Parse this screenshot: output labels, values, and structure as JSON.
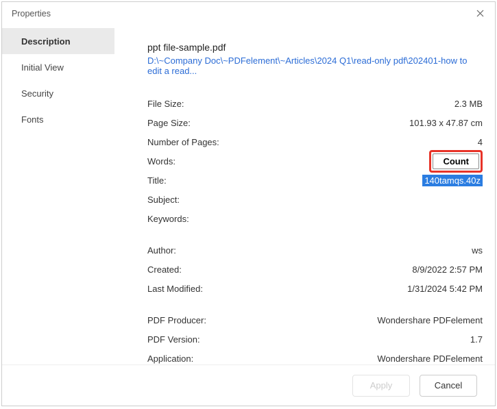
{
  "window": {
    "title": "Properties"
  },
  "sidebar": {
    "items": [
      {
        "label": "Description"
      },
      {
        "label": "Initial View"
      },
      {
        "label": "Security"
      },
      {
        "label": "Fonts"
      }
    ]
  },
  "file": {
    "name": "ppt file-sample.pdf",
    "path": "D:\\~Company Doc\\~PDFelement\\~Articles\\2024 Q1\\read-only pdf\\202401-how to edit a read..."
  },
  "rows": {
    "file_size": {
      "label": "File Size:",
      "value": "2.3 MB"
    },
    "page_size": {
      "label": "Page Size:",
      "value": "101.93 x 47.87 cm"
    },
    "pages": {
      "label": "Number of Pages:",
      "value": "4"
    },
    "words": {
      "label": "Words:",
      "count_button": "Count"
    },
    "title": {
      "label": "Title:",
      "value": "140tamqs.40z"
    },
    "subject": {
      "label": "Subject:",
      "value": ""
    },
    "keywords": {
      "label": "Keywords:",
      "value": ""
    },
    "author": {
      "label": "Author:",
      "value": "ws"
    },
    "created": {
      "label": "Created:",
      "value": "8/9/2022 2:57 PM"
    },
    "modified": {
      "label": "Last Modified:",
      "value": "1/31/2024 5:42 PM"
    },
    "producer": {
      "label": "PDF Producer:",
      "value": "Wondershare PDFelement"
    },
    "version": {
      "label": "PDF Version:",
      "value": "1.7"
    },
    "application": {
      "label": "Application:",
      "value": "Wondershare PDFelement"
    }
  },
  "footer": {
    "apply": "Apply",
    "cancel": "Cancel"
  }
}
